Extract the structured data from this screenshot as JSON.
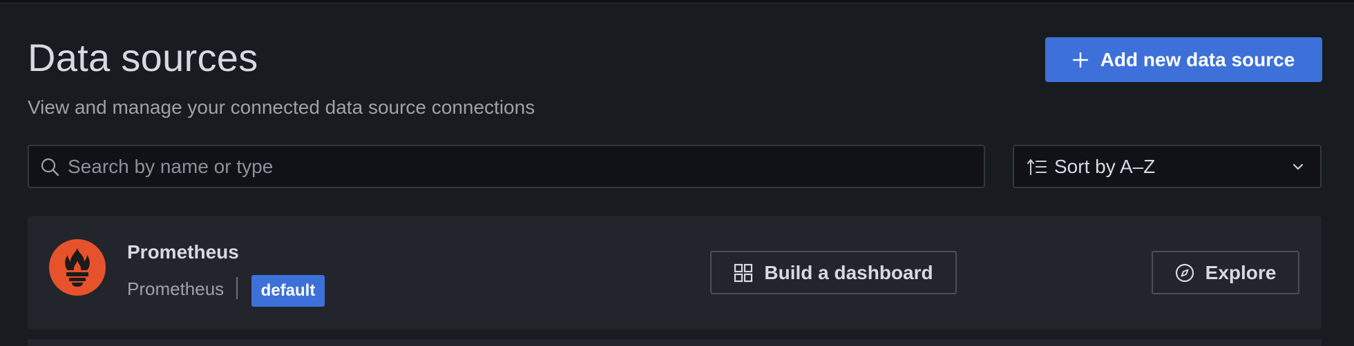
{
  "header": {
    "title": "Data sources",
    "subtitle": "View and manage your connected data source connections",
    "add_button_label": "Add new data source"
  },
  "search": {
    "placeholder": "Search by name or type",
    "value": ""
  },
  "sort": {
    "selected": "Sort by A–Z"
  },
  "data_sources": [
    {
      "name": "Prometheus",
      "type": "Prometheus",
      "badge": "default",
      "actions": {
        "build_dashboard": "Build a dashboard",
        "explore": "Explore"
      }
    }
  ],
  "colors": {
    "accent": "#3d71d9",
    "prometheus_brand": "#e6522c",
    "background": "#181b1f",
    "card": "#22252b"
  },
  "icons": {
    "add": "plus-icon",
    "search": "search-icon",
    "sort": "sort-ascending-icon",
    "dropdown": "chevron-down-icon",
    "logo": "prometheus-logo-icon",
    "dashboard": "apps-grid-icon",
    "explore": "compass-icon"
  }
}
